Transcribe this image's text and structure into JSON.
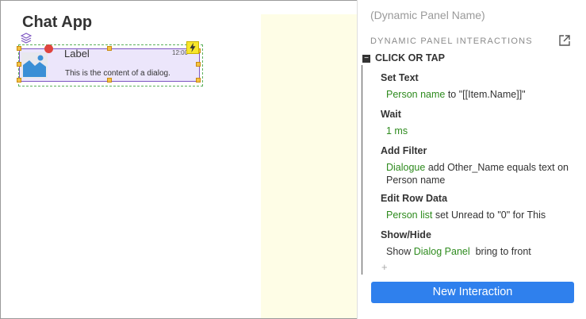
{
  "canvas": {
    "title": "Chat App",
    "widget": {
      "label": "Label",
      "time": "12:00",
      "content": "This is the content of a dialog."
    }
  },
  "panel": {
    "name_placeholder": "(Dynamic Panel Name)",
    "section_title": "DYNAMIC PANEL INTERACTIONS",
    "event": "CLICK OR TAP",
    "actions": [
      {
        "title": "Set Text",
        "target": "Person name",
        "detail": " to \"[[Item.Name]]\""
      },
      {
        "title": "Wait",
        "target": "1 ms",
        "detail": ""
      },
      {
        "title": "Add Filter",
        "target": "Dialogue",
        "detail": " add Other_Name equals text on Person name"
      },
      {
        "title": "Edit Row Data",
        "target": "Person list",
        "detail": " set Unread to \"0\" for This"
      },
      {
        "title": "Show/Hide",
        "prefix": "Show ",
        "target": "Dialog Panel",
        "detail": "  bring to front"
      }
    ],
    "add_symbol": "+",
    "new_interaction_label": "New Interaction"
  },
  "colors": {
    "accent_blue": "#2f80ed",
    "link_green": "#2e8b1e",
    "widget_fill": "#ece6fb",
    "yellow_area": "#fefde6"
  },
  "icons": [
    "layers-icon",
    "image-icon",
    "lightning-icon",
    "popout-icon",
    "collapse-icon"
  ]
}
